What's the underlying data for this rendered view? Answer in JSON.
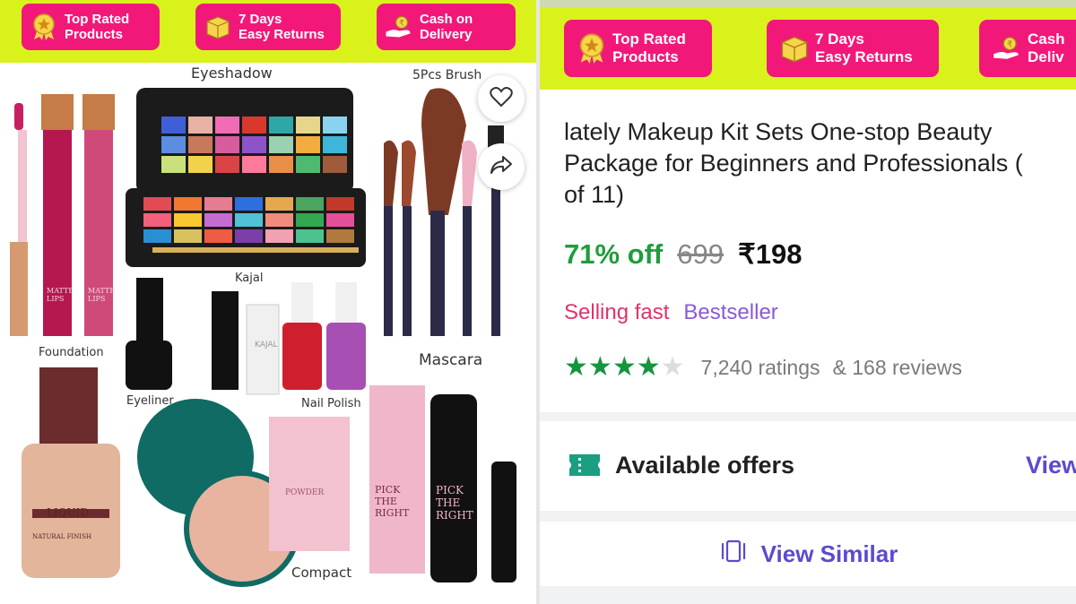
{
  "banner": {
    "badges": [
      {
        "line1": "Top Rated",
        "line2": "Products",
        "icon": "medal-icon"
      },
      {
        "line1": "7 Days",
        "line2": "Easy Returns",
        "icon": "box-icon"
      },
      {
        "line1": "Cash on",
        "line2": "Delivery",
        "icon": "hand-coin-icon"
      }
    ],
    "right_badges": [
      {
        "line1": "Top Rated",
        "line2": "Products"
      },
      {
        "line1": "7 Days",
        "line2": "Easy Returns"
      },
      {
        "line1": "Cash",
        "line2": "Deliv"
      }
    ],
    "colors": {
      "banner": "#d9f21c",
      "badge": "#f2187a"
    }
  },
  "product_image": {
    "labels": {
      "eyeshadow": "Eyeshadow",
      "brush": "5Pcs Brush",
      "kajal": "Kajal",
      "foundation": "Foundation",
      "eyeliner": "Eyeliner",
      "nail_polish": "Nail Polish",
      "mascara": "Mascara",
      "compact": "Compact",
      "lips_1": "MATTE LIPS",
      "lips_2": "MATTE LIPS",
      "liquid_1": "LIQUID",
      "liquid_2": "FOUNDATION",
      "liquid_3": "NATURAL FINISH",
      "pick_1": "PICK THE RIGHT",
      "pick_2": "PICK THE RIGHT",
      "kajal_tube": "KAJAL",
      "powder": "POWDER"
    },
    "actions": {
      "wishlist_icon": "heart-icon",
      "share_icon": "share-icon"
    }
  },
  "details": {
    "title": "lately Makeup Kit Sets One-stop Beauty\nPackage for Beginners and Professionals (\nof 11)",
    "discount": "71% off",
    "mrp": "699",
    "price": "₹198",
    "tags": [
      "Selling fast",
      "Bestseller"
    ],
    "rating": {
      "stars": 4,
      "max": 5,
      "ratings_text": "7,240 ratings",
      "reviews_text": "& 168 reviews"
    },
    "offers": {
      "label": "Available offers",
      "view": "View"
    },
    "similar": {
      "label": "View Similar"
    }
  }
}
